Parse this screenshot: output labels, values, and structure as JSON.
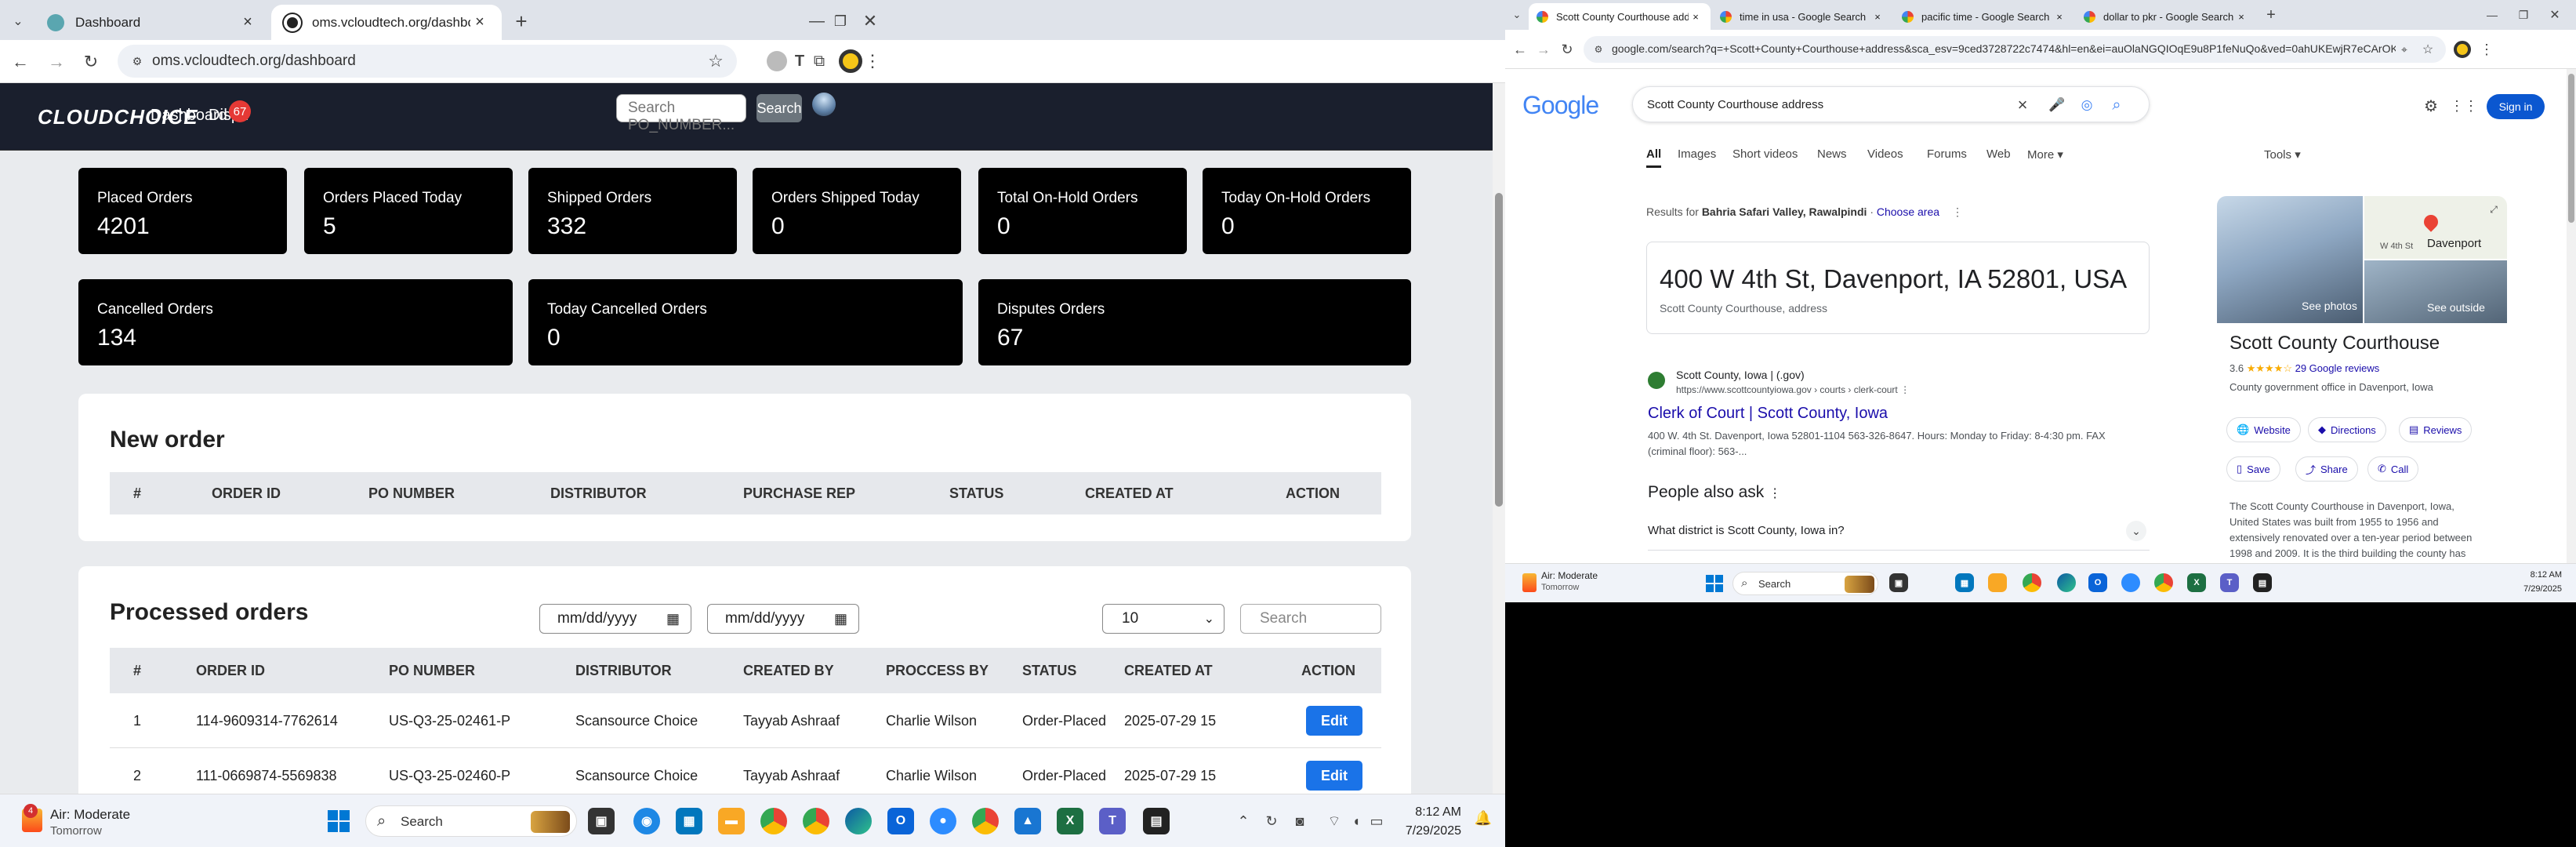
{
  "left_browser": {
    "tabs": [
      {
        "label": "Dashboard",
        "active": false
      },
      {
        "label": "oms.vcloudtech.org/dashboard",
        "active": true
      }
    ],
    "url": "oms.vcloudtech.org/dashboard",
    "app": {
      "logo": "CLOUDCHOICE",
      "nav": [
        {
          "label": "Dashboard"
        },
        {
          "label": "Dispu"
        }
      ],
      "disputes_badge": "67",
      "search_placeholder": "Search PO_NUMBER...",
      "search_button": "Search"
    },
    "stats_row1": [
      {
        "label": "Placed Orders",
        "value": "4201"
      },
      {
        "label": "Orders Placed Today",
        "value": "5"
      },
      {
        "label": "Shipped Orders",
        "value": "332"
      },
      {
        "label": "Orders Shipped Today",
        "value": "0"
      },
      {
        "label": "Total On-Hold Orders",
        "value": "0"
      },
      {
        "label": "Today On-Hold Orders",
        "value": "0"
      }
    ],
    "stats_row2": [
      {
        "label": "Cancelled Orders",
        "value": "134"
      },
      {
        "label": "Today Cancelled Orders",
        "value": "0"
      },
      {
        "label": "Disputes Orders",
        "value": "67"
      }
    ],
    "new_order": {
      "title": "New order",
      "columns": [
        "#",
        "ORDER ID",
        "PO NUMBER",
        "DISTRIBUTOR",
        "PURCHASE REP",
        "STATUS",
        "CREATED AT",
        "ACTION"
      ]
    },
    "processed": {
      "title": "Processed orders",
      "date_placeholder_1": "mm/dd/yyyy",
      "date_placeholder_2": "mm/dd/yyyy",
      "page_size": "10",
      "search_placeholder": "Search",
      "columns": [
        "#",
        "ORDER ID",
        "PO NUMBER",
        "DISTRIBUTOR",
        "CREATED BY",
        "PROCCESS BY",
        "STATUS",
        "CREATED AT",
        "ACTION"
      ],
      "rows": [
        {
          "num": "1",
          "order_id": "114-9609314-7762614",
          "po": "US-Q3-25-02461-P",
          "distributor": "Scansource Choice",
          "created_by": "Tayyab Ashraaf",
          "process_by": "Charlie Wilson",
          "status": "Order-Placed",
          "created_at": "2025-07-29 15",
          "action": "Edit"
        },
        {
          "num": "2",
          "order_id": "111-0669874-5569838",
          "po": "US-Q3-25-02460-P",
          "distributor": "Scansource Choice",
          "created_by": "Tayyab Ashraaf",
          "process_by": "Charlie Wilson",
          "status": "Order-Placed",
          "created_at": "2025-07-29 15",
          "action": "Edit"
        }
      ]
    },
    "taskbar": {
      "weather": "Air: Moderate",
      "weather_sub": "Tomorrow",
      "weather_badge": "4",
      "search": "Search",
      "time": "8:12 AM",
      "date": "7/29/2025"
    }
  },
  "right_browser": {
    "tabs": [
      {
        "label": "Scott County Courthouse addr",
        "active": true
      },
      {
        "label": "time in usa - Google Search",
        "active": false
      },
      {
        "label": "pacific time - Google Search",
        "active": false
      },
      {
        "label": "dollar to pkr - Google Search",
        "active": false
      }
    ],
    "url": "google.com/search?q=+Scott+County+Courthouse+address&sca_esv=9ced3728722c7474&hl=en&ei=auOlaNGQIOqE9u8P1feNuQo&ved=0ahUKEwjR7eCArOKOAxVq...",
    "google": {
      "logo": "Google",
      "query": "Scott County Courthouse address",
      "sign_in": "Sign in",
      "tabs": [
        "All",
        "Images",
        "Short videos",
        "News",
        "Videos",
        "Forums",
        "Web",
        "More",
        "Tools"
      ],
      "results_for_prefix": "Results for",
      "results_location": "Bahria Safari Valley, Rawalpindi",
      "choose_area": "Choose area",
      "address": "400 W 4th St, Davenport, IA 52801, USA",
      "address_sub": "Scott County Courthouse, address",
      "result_site": "Scott County, Iowa | (.gov)",
      "result_url": "https://www.scottcountyiowa.gov › courts › clerk-court",
      "result_title": "Clerk of Court | Scott County, Iowa",
      "result_snippet_1": "400 W. 4th St. Davenport, Iowa 52801-1104 563-326-8647. Hours: Monday to Friday: 8-4:30 pm. FAX",
      "result_snippet_2": "(criminal floor): 563-...",
      "paa_title": "People also ask",
      "paa_q1": "What district is Scott County, Iowa in?",
      "kp_title": "Scott County Courthouse",
      "kp_rating": "3.6",
      "kp_stars": "★★★★☆",
      "kp_reviews": "29 Google reviews",
      "kp_type": "County government office in Davenport, Iowa",
      "kp_buttons": [
        "Website",
        "Directions",
        "Reviews",
        "Save",
        "Share",
        "Call"
      ],
      "see_photos": "See photos",
      "see_outside": "See outside",
      "map_label_1": "Davenport",
      "map_label_2": "W 4th St",
      "kp_desc_1": "The Scott County Courthouse in Davenport, Iowa,",
      "kp_desc_2": "United States was built from 1955 to 1956 and",
      "kp_desc_3": "extensively renovated over a ten-year period between",
      "kp_desc_4": "1998 and 2009. It is the third building the county has"
    },
    "taskbar": {
      "weather": "Air: Moderate",
      "weather_sub": "Tomorrow",
      "search": "Search",
      "time": "8:12 AM",
      "date": "7/29/2025"
    }
  }
}
